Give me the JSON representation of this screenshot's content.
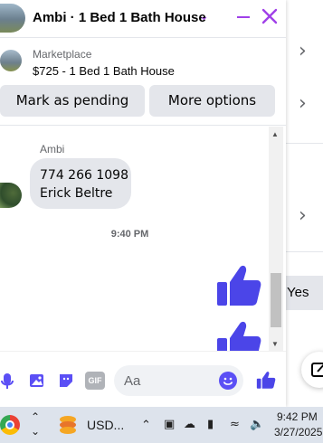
{
  "header": {
    "title": "Ambi · 1 Bed 1 Bath House"
  },
  "marketplace": {
    "label": "Marketplace",
    "listing": "$725 - 1 Bed 1 Bath House"
  },
  "actions": {
    "pending_label": "Mark as pending",
    "more_label": "More options"
  },
  "conversation": {
    "sender_name": "Ambi",
    "message_line1": "774 266 1098",
    "message_line2": "Erick Beltre",
    "timestamp": "9:40 PM"
  },
  "composer": {
    "placeholder": "Aa",
    "gif_label": "GIF"
  },
  "background": {
    "yes_label": "Yes"
  },
  "taskbar": {
    "app_label": "USD...",
    "time": "9:42 PM",
    "date": "3/27/2025"
  },
  "colors": {
    "accent": "#a040e8",
    "messenger": "#5b4ff5",
    "like": "#4b45e8"
  }
}
